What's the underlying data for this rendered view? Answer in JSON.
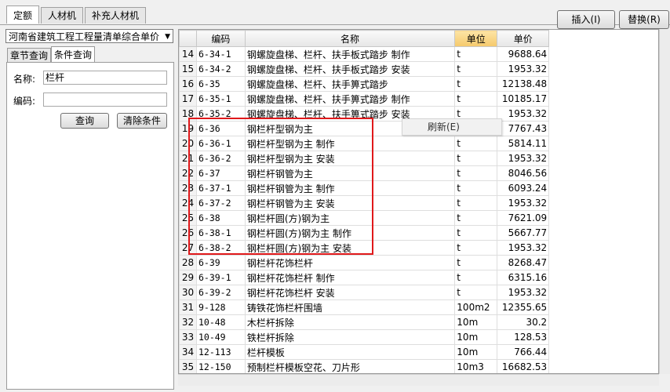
{
  "top_tabs": [
    "定额",
    "人材机",
    "补充人材机"
  ],
  "toolbar": {
    "insert": "插入(I)",
    "replace": "替换(R)"
  },
  "left": {
    "combo": "河南省建筑工程工程量清单综合单价",
    "tabs": [
      "章节查询",
      "条件查询"
    ],
    "name_label": "名称:",
    "name_value": "栏杆",
    "code_label": "编码:",
    "code_value": "",
    "query_button": "查询",
    "clear_button": "清除条件"
  },
  "table": {
    "headers": [
      "",
      "编码",
      "名称",
      "单位",
      "单价"
    ],
    "rows": [
      [
        "14",
        "6-34-1",
        "钢螺旋盘梯、栏杆、扶手板式踏步 制作",
        "t",
        "9688.64"
      ],
      [
        "15",
        "6-34-2",
        "钢螺旋盘梯、栏杆、扶手板式踏步 安装",
        "t",
        "1953.32"
      ],
      [
        "16",
        "6-35",
        "钢螺旋盘梯、栏杆、扶手箅式踏步",
        "t",
        "12138.48"
      ],
      [
        "17",
        "6-35-1",
        "钢螺旋盘梯、栏杆、扶手箅式踏步 制作",
        "t",
        "10185.17"
      ],
      [
        "18",
        "6-35-2",
        "钢螺旋盘梯、栏杆、扶手箅式踏步 安装",
        "t",
        "1953.32"
      ],
      [
        "19",
        "6-36",
        "钢栏杆型钢为主",
        "",
        "7767.43"
      ],
      [
        "20",
        "6-36-1",
        "钢栏杆型钢为主 制作",
        "t",
        "5814.11"
      ],
      [
        "21",
        "6-36-2",
        "钢栏杆型钢为主 安装",
        "t",
        "1953.32"
      ],
      [
        "22",
        "6-37",
        "钢栏杆钢管为主",
        "t",
        "8046.56"
      ],
      [
        "23",
        "6-37-1",
        "钢栏杆钢管为主 制作",
        "t",
        "6093.24"
      ],
      [
        "24",
        "6-37-2",
        "钢栏杆钢管为主 安装",
        "t",
        "1953.32"
      ],
      [
        "25",
        "6-38",
        "钢栏杆圆(方)钢为主",
        "t",
        "7621.09"
      ],
      [
        "26",
        "6-38-1",
        "钢栏杆圆(方)钢为主 制作",
        "t",
        "5667.77"
      ],
      [
        "27",
        "6-38-2",
        "钢栏杆圆(方)钢为主 安装",
        "t",
        "1953.32"
      ],
      [
        "28",
        "6-39",
        "钢栏杆花饰栏杆",
        "t",
        "8268.47"
      ],
      [
        "29",
        "6-39-1",
        "钢栏杆花饰栏杆 制作",
        "t",
        "6315.16"
      ],
      [
        "30",
        "6-39-2",
        "钢栏杆花饰栏杆 安装",
        "t",
        "1953.32"
      ],
      [
        "31",
        "9-128",
        "铸铁花饰栏杆围墙",
        "100m2",
        "12355.65"
      ],
      [
        "32",
        "10-48",
        "木栏杆拆除",
        "10m",
        "30.2"
      ],
      [
        "33",
        "10-49",
        "铁栏杆拆除",
        "10m",
        "128.53"
      ],
      [
        "34",
        "12-113",
        "栏杆模板",
        "10m",
        "766.44"
      ],
      [
        "35",
        "12-150",
        "预制栏杆模板空花、刀片形",
        "10m3",
        "16682.53"
      ]
    ]
  },
  "context_menu": {
    "refresh": "刷新(E)"
  },
  "colors": {
    "highlight": "#e0191b",
    "selected_header": "#f5c96b"
  }
}
